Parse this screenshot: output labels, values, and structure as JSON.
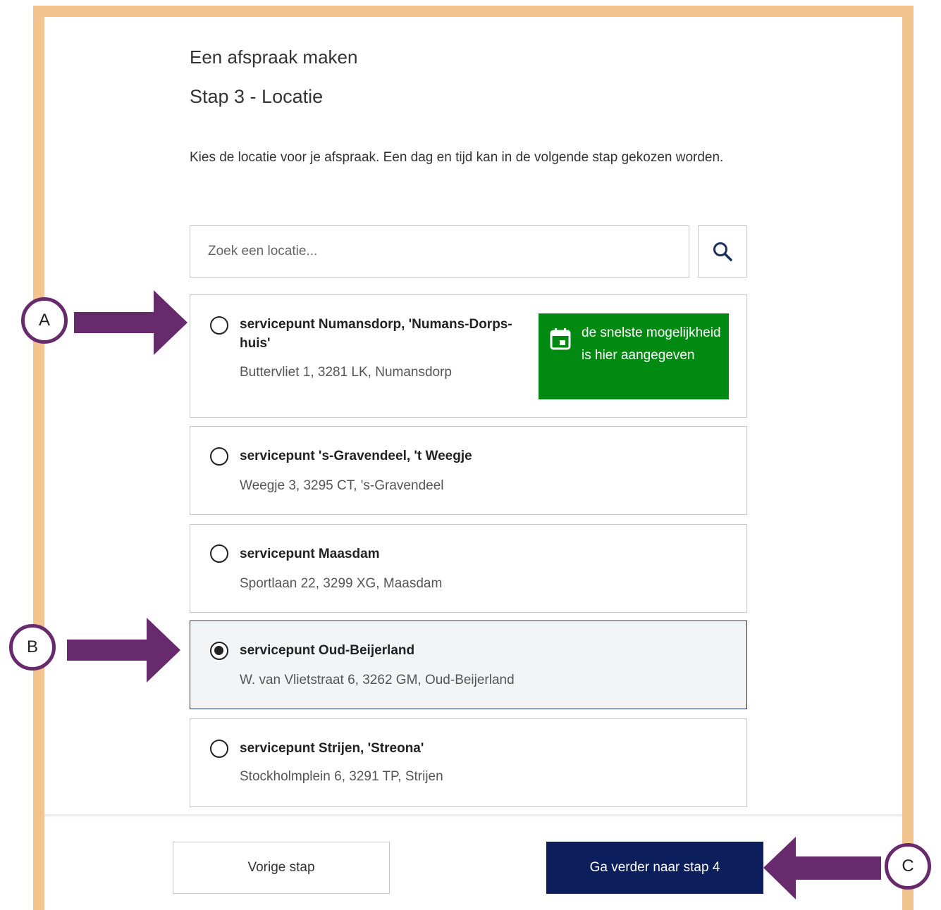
{
  "page": {
    "title": "Een afspraak maken",
    "step": "Stap 3 - Locatie",
    "intro": "Kies de locatie voor je afspraak. Een dag en tijd kan in de volgende stap gekozen worden."
  },
  "search": {
    "placeholder": "Zoek een locatie...",
    "icon": "search-icon"
  },
  "locations": [
    {
      "name": "servicepunt Numansdorp, 'Numans-Dorps-huis'",
      "address": "Buttervliet 1, 3281 LK, Numansdorp",
      "selected": false
    },
    {
      "name": "servicepunt 's-Gravendeel, 't Weegje",
      "address": "Weegje 3, 3295 CT, 's-Gravendeel",
      "selected": false
    },
    {
      "name": "servicepunt Maasdam",
      "address": "Sportlaan 22, 3299 XG, Maasdam",
      "selected": false
    },
    {
      "name": "servicepunt Oud-Beijerland",
      "address": "W. van Vlietstraat 6, 3262 GM, Oud-Beijerland",
      "selected": true
    },
    {
      "name": "servicepunt Strijen, 'Streona'",
      "address": "Stockholmplein 6, 3291 TP, Strijen",
      "selected": false
    }
  ],
  "badge": {
    "text": "de snelste mogelijkheid is hier aangegeven",
    "icon": "calendar-icon",
    "color": "#008a12"
  },
  "footer": {
    "prev_label": "Vorige stap",
    "next_label": "Ga verder naar stap 4"
  },
  "annotations": {
    "a": "A",
    "b": "B",
    "c": "C",
    "color": "#672b6d"
  },
  "colors": {
    "frame": "#f3c48e",
    "primary_button": "#0c1f5c"
  }
}
